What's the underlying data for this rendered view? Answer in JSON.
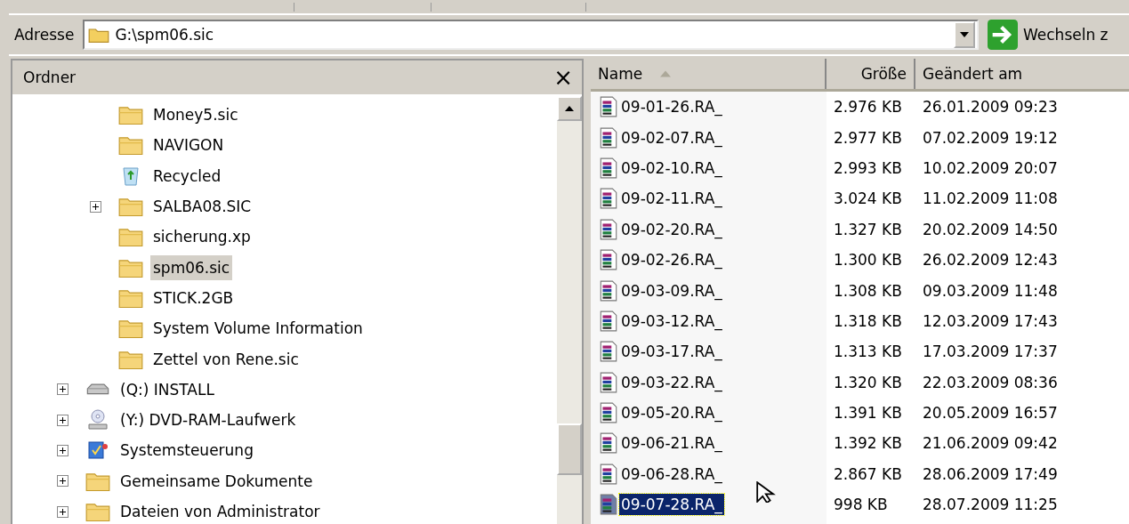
{
  "address": {
    "label": "Adresse",
    "value": "G:\\spm06.sic",
    "go_label": "Wechseln z"
  },
  "folders_pane": {
    "title": "Ordner",
    "close": "×",
    "tree": [
      {
        "children": [
          {
            "label": "Money5.sic",
            "kind": "folder",
            "expandable": false,
            "selected": false
          },
          {
            "label": "NAVIGON",
            "kind": "folder",
            "expandable": false,
            "selected": false
          },
          {
            "label": "Recycled",
            "kind": "recycle",
            "expandable": false,
            "selected": false
          },
          {
            "label": "SALBA08.SIC",
            "kind": "folder",
            "expandable": true,
            "selected": false
          },
          {
            "label": "sicherung.xp",
            "kind": "folder",
            "expandable": false,
            "selected": false
          },
          {
            "label": "spm06.sic",
            "kind": "folder",
            "expandable": false,
            "selected": true
          },
          {
            "label": "STICK.2GB",
            "kind": "folder",
            "expandable": false,
            "selected": false
          },
          {
            "label": "System Volume Information",
            "kind": "folder",
            "expandable": false,
            "selected": false
          },
          {
            "label": "Zettel von Rene.sic",
            "kind": "folder",
            "expandable": false,
            "selected": false
          }
        ]
      },
      {
        "label": "(Q:) INSTALL",
        "kind": "drive",
        "expandable": true,
        "selected": false
      },
      {
        "label": "(Y:) DVD-RAM-Laufwerk",
        "kind": "dvd",
        "expandable": true,
        "selected": false
      },
      {
        "label": "Systemsteuerung",
        "kind": "control",
        "expandable": true,
        "selected": false
      },
      {
        "label": "Gemeinsame Dokumente",
        "kind": "folder",
        "expandable": true,
        "selected": false
      },
      {
        "label": "Dateien von Administrator",
        "kind": "folder",
        "expandable": true,
        "selected": false
      }
    ]
  },
  "file_list": {
    "columns": [
      "Name",
      "Größe",
      "Geändert am"
    ],
    "rows": [
      {
        "name": "09-01-26.RA_",
        "size": "2.976 KB",
        "modified": "26.01.2009 09:23",
        "selected": false
      },
      {
        "name": "09-02-07.RA_",
        "size": "2.977 KB",
        "modified": "07.02.2009 19:12",
        "selected": false
      },
      {
        "name": "09-02-10.RA_",
        "size": "2.993 KB",
        "modified": "10.02.2009 20:07",
        "selected": false
      },
      {
        "name": "09-02-11.RA_",
        "size": "3.024 KB",
        "modified": "11.02.2009 11:08",
        "selected": false
      },
      {
        "name": "09-02-20.RA_",
        "size": "1.327 KB",
        "modified": "20.02.2009 14:50",
        "selected": false
      },
      {
        "name": "09-02-26.RA_",
        "size": "1.300 KB",
        "modified": "26.02.2009 12:43",
        "selected": false
      },
      {
        "name": "09-03-09.RA_",
        "size": "1.308 KB",
        "modified": "09.03.2009 11:48",
        "selected": false
      },
      {
        "name": "09-03-12.RA_",
        "size": "1.318 KB",
        "modified": "12.03.2009 17:43",
        "selected": false
      },
      {
        "name": "09-03-17.RA_",
        "size": "1.313 KB",
        "modified": "17.03.2009 17:37",
        "selected": false
      },
      {
        "name": "09-03-22.RA_",
        "size": "1.320 KB",
        "modified": "22.03.2009 08:36",
        "selected": false
      },
      {
        "name": "09-05-20.RA_",
        "size": "1.391 KB",
        "modified": "20.05.2009 16:57",
        "selected": false
      },
      {
        "name": "09-06-21.RA_",
        "size": "1.392 KB",
        "modified": "21.06.2009 09:42",
        "selected": false
      },
      {
        "name": "09-06-28.RA_",
        "size": "2.867 KB",
        "modified": "28.06.2009 17:49",
        "selected": false
      },
      {
        "name": "09-07-28.RA_",
        "size": "998 KB",
        "modified": "28.07.2009 11:25",
        "selected": true
      }
    ]
  }
}
